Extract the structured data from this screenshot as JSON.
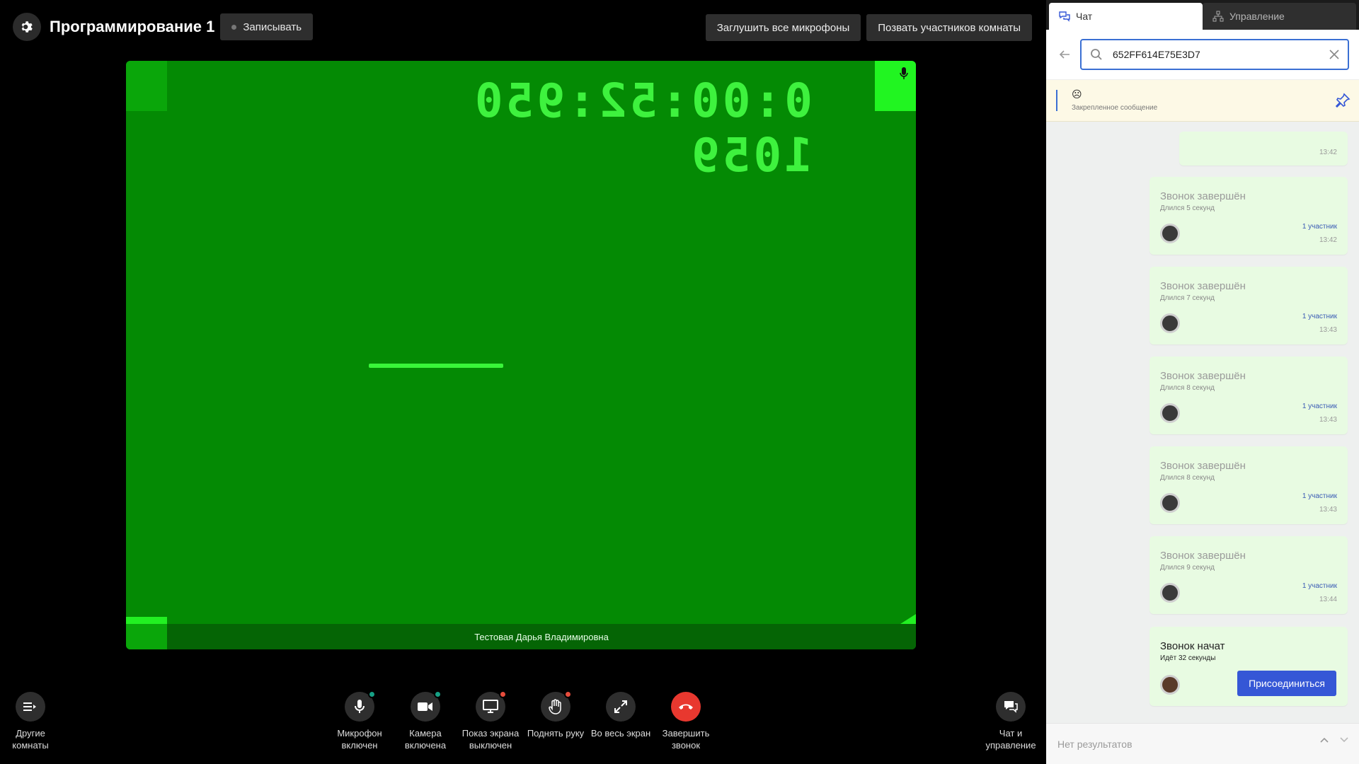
{
  "header": {
    "title": "Программирование 1",
    "record_label": "Записывать",
    "mute_all_label": "Заглушить все микрофоны",
    "invite_label": "Позвать участников комнаты"
  },
  "video": {
    "timecode": "0:00:52:950 1059",
    "participant_name": "Тестовая Дарья Владимировна"
  },
  "controls": {
    "rooms": "Другие комнаты",
    "mic": "Микрофон включен",
    "camera": "Камера включена",
    "screen": "Показ экрана выключен",
    "hand": "Поднять руку",
    "fullscreen": "Во весь экран",
    "end": "Завершить звонок",
    "chat": "Чат и управление"
  },
  "panel": {
    "tab_chat": "Чат",
    "tab_manage": "Управление",
    "search_value": "652FF614E75E3D7",
    "pinned_emoji": "☹",
    "pinned_label": "Закрепленное сообщение",
    "first_time": "13:42",
    "messages": [
      {
        "title": "Звонок завершён",
        "duration": "Длился 5 секунд",
        "participants": "1 участник",
        "time": "13:42"
      },
      {
        "title": "Звонок завершён",
        "duration": "Длился 7 секунд",
        "participants": "1 участник",
        "time": "13:43"
      },
      {
        "title": "Звонок завершён",
        "duration": "Длился 8 секунд",
        "participants": "1 участник",
        "time": "13:43"
      },
      {
        "title": "Звонок завершён",
        "duration": "Длился 8 секунд",
        "participants": "1 участник",
        "time": "13:43"
      },
      {
        "title": "Звонок завершён",
        "duration": "Длился 9 секунд",
        "participants": "1 участник",
        "time": "13:44"
      }
    ],
    "active_call": {
      "title": "Звонок начат",
      "duration": "Идёт 32 секунды",
      "join_label": "Присоединиться"
    },
    "no_results": "Нет результатов"
  },
  "colors": {
    "accent": "#3557d6",
    "video_bg": "#048a04",
    "end_call": "#e8382f",
    "badge_on": "#16a085",
    "badge_off": "#e74c3c"
  }
}
